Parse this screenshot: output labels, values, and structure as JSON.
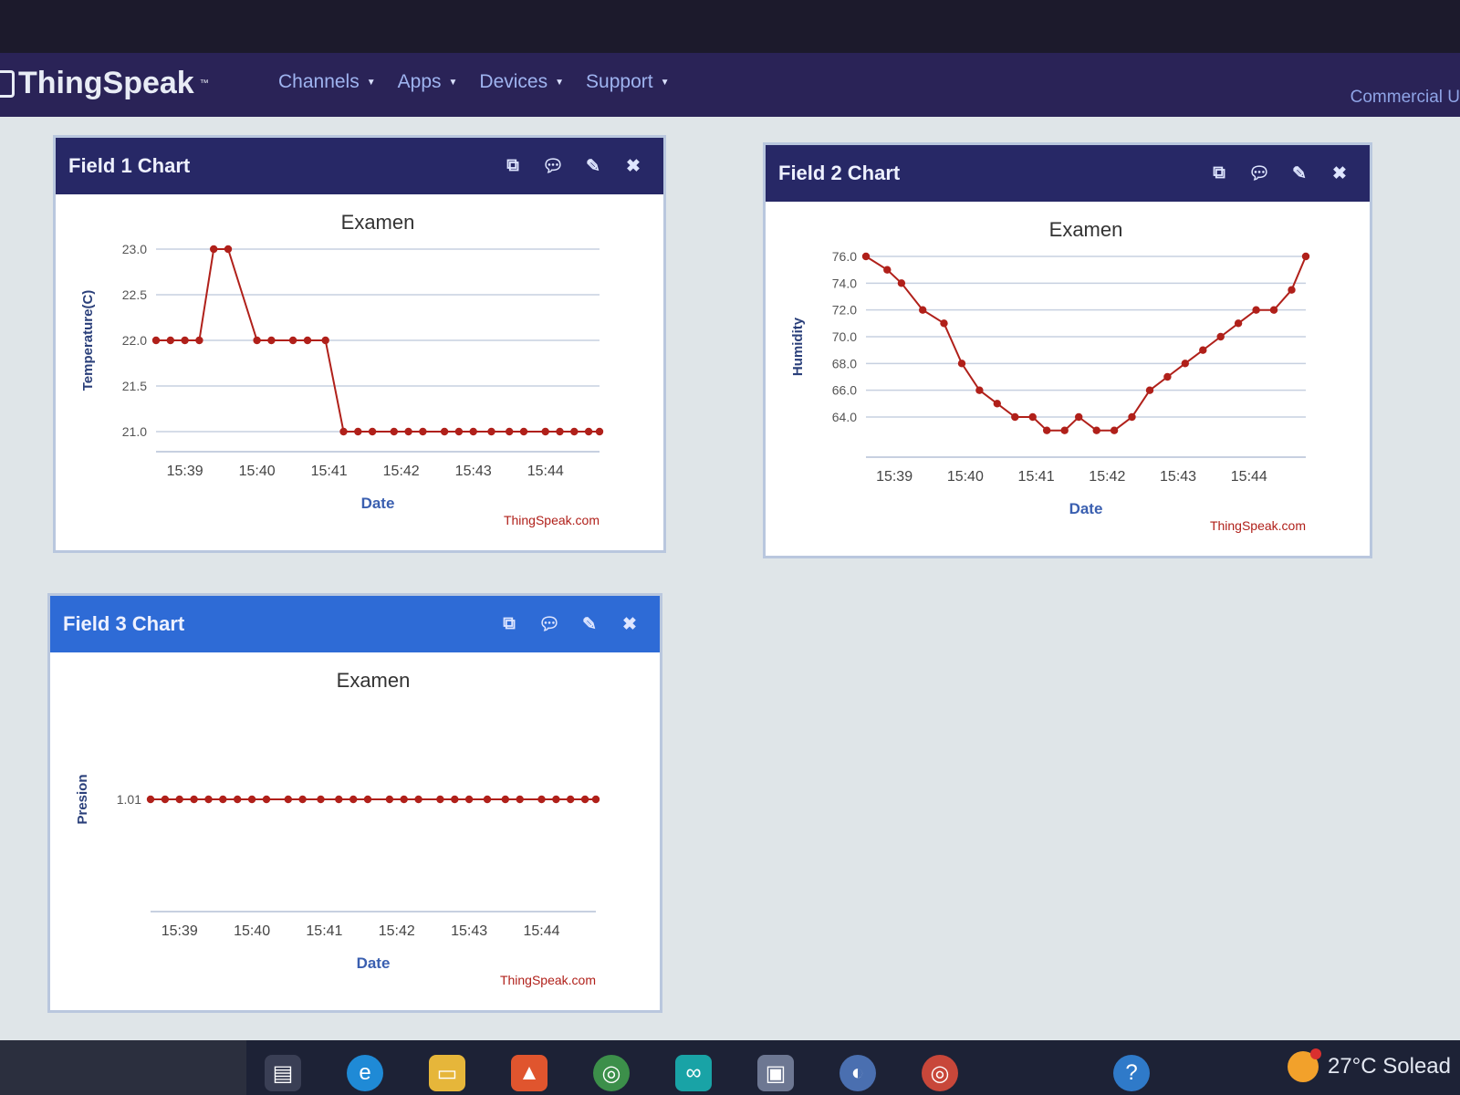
{
  "app": {
    "brand": "ThingSpeak",
    "brand_mark": "™",
    "nav": [
      "Channels",
      "Apps",
      "Devices",
      "Support"
    ],
    "commercial": "Commercial U"
  },
  "panels": [
    {
      "title": "Field 1 Chart",
      "header_style": "dark",
      "chart_data": {
        "type": "line",
        "title": "Examen",
        "xlabel": "Date",
        "ylabel": "Temperature(C)",
        "credit": "ThingSpeak.com",
        "color": "#b0201a",
        "xlim": [
          38.6,
          44.75
        ],
        "ylim": [
          21.0,
          23.0
        ],
        "yticks": [
          "23.0",
          "22.5",
          "22.0",
          "21.5",
          "21.0"
        ],
        "ytick_values": [
          23.0,
          22.5,
          22.0,
          21.5,
          21.0
        ],
        "xticks": [
          "15:39",
          "15:40",
          "15:41",
          "15:42",
          "15:43",
          "15:44"
        ],
        "xtick_values": [
          39,
          40,
          41,
          42,
          43,
          44
        ],
        "x": [
          38.6,
          38.8,
          39.0,
          39.2,
          39.4,
          39.6,
          40.0,
          40.2,
          40.5,
          40.7,
          40.95,
          41.2,
          41.4,
          41.6,
          41.9,
          42.1,
          42.3,
          42.6,
          42.8,
          43.0,
          43.25,
          43.5,
          43.7,
          44.0,
          44.2,
          44.4,
          44.6,
          44.75
        ],
        "y": [
          22.0,
          22.0,
          22.0,
          22.0,
          23.0,
          23.0,
          22.0,
          22.0,
          22.0,
          22.0,
          22.0,
          21.0,
          21.0,
          21.0,
          21.0,
          21.0,
          21.0,
          21.0,
          21.0,
          21.0,
          21.0,
          21.0,
          21.0,
          21.0,
          21.0,
          21.0,
          21.0,
          21.0
        ]
      }
    },
    {
      "title": "Field 2 Chart",
      "header_style": "dark",
      "chart_data": {
        "type": "line",
        "title": "Examen",
        "xlabel": "Date",
        "ylabel": "Humidity",
        "credit": "ThingSpeak.com",
        "color": "#b0201a",
        "xlim": [
          38.6,
          44.8
        ],
        "ylim": [
          62.5,
          76.0
        ],
        "yticks": [
          "76.0",
          "74.0",
          "72.0",
          "70.0",
          "68.0",
          "66.0",
          "64.0"
        ],
        "ytick_values": [
          76,
          74,
          72,
          70,
          68,
          66,
          64
        ],
        "xticks": [
          "15:39",
          "15:40",
          "15:41",
          "15:42",
          "15:43",
          "15:44"
        ],
        "xtick_values": [
          39,
          40,
          41,
          42,
          43,
          44
        ],
        "x": [
          38.6,
          38.9,
          39.1,
          39.4,
          39.7,
          39.95,
          40.2,
          40.45,
          40.7,
          40.95,
          41.15,
          41.4,
          41.6,
          41.85,
          42.1,
          42.35,
          42.6,
          42.85,
          43.1,
          43.35,
          43.6,
          43.85,
          44.1,
          44.35,
          44.6,
          44.8
        ],
        "y": [
          76.0,
          75.0,
          74.0,
          72.0,
          71.0,
          68.0,
          66.0,
          65.0,
          64.0,
          64.0,
          63.0,
          63.0,
          64.0,
          63.0,
          63.0,
          64.0,
          66.0,
          67.0,
          68.0,
          69.0,
          70.0,
          71.0,
          72.0,
          72.0,
          73.5,
          76.0
        ]
      }
    },
    {
      "title": "Field 3 Chart",
      "header_style": "blue",
      "chart_data": {
        "type": "line",
        "title": "Examen",
        "xlabel": "Date",
        "ylabel": "Presion",
        "credit": "ThingSpeak.com",
        "color": "#b0201a",
        "xlim": [
          38.6,
          44.75
        ],
        "ylim": [
          1.01,
          1.01
        ],
        "yticks": [
          "1.01"
        ],
        "ytick_values": [
          1.01
        ],
        "xticks": [
          "15:39",
          "15:40",
          "15:41",
          "15:42",
          "15:43",
          "15:44"
        ],
        "xtick_values": [
          39,
          40,
          41,
          42,
          43,
          44
        ],
        "x": [
          38.6,
          38.8,
          39.0,
          39.2,
          39.4,
          39.6,
          39.8,
          40.0,
          40.2,
          40.5,
          40.7,
          40.95,
          41.2,
          41.4,
          41.6,
          41.9,
          42.1,
          42.3,
          42.6,
          42.8,
          43.0,
          43.25,
          43.5,
          43.7,
          44.0,
          44.2,
          44.4,
          44.6,
          44.75
        ],
        "y": [
          1.01,
          1.01,
          1.01,
          1.01,
          1.01,
          1.01,
          1.01,
          1.01,
          1.01,
          1.01,
          1.01,
          1.01,
          1.01,
          1.01,
          1.01,
          1.01,
          1.01,
          1.01,
          1.01,
          1.01,
          1.01,
          1.01,
          1.01,
          1.01,
          1.01,
          1.01,
          1.01,
          1.01,
          1.01
        ]
      }
    }
  ],
  "panel_icons": [
    "external-link-icon",
    "comment-icon",
    "pencil-icon",
    "close-icon"
  ],
  "taskbar": {
    "weather": "27°C Solead",
    "icons": [
      "widgets-icon",
      "edge-icon",
      "file-explorer-icon",
      "brave-icon",
      "chrome-icon",
      "arduino-icon",
      "app-icon",
      "app-icon-2",
      "chrome-icon-2",
      "help-icon"
    ]
  }
}
